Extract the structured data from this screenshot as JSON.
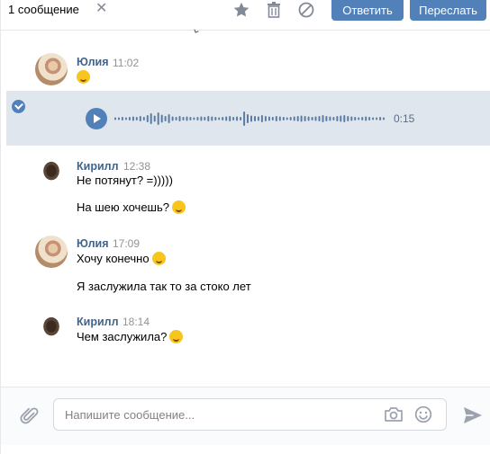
{
  "header": {
    "selection_count": "1 сообщение",
    "reply_label": "Ответить",
    "forward_label": "Переслать"
  },
  "messages": [
    {
      "author": "Юлия",
      "time": "11:02",
      "lines": [
        ""
      ],
      "emoji_after": [
        true
      ]
    },
    {
      "author": "Кирилл",
      "time": "12:38",
      "lines": [
        "Не потянут? =)))))",
        "На шею хочешь?"
      ],
      "emoji_after": [
        false,
        true
      ]
    },
    {
      "author": "Юлия",
      "time": "17:09",
      "lines": [
        "Хочу конечно",
        "Я заслужила так то за стоко лет"
      ],
      "emoji_after": [
        true,
        false
      ]
    },
    {
      "author": "Кирилл",
      "time": "18:14",
      "lines": [
        "Чем заслужила?"
      ],
      "emoji_after": [
        true
      ]
    }
  ],
  "voice_message": {
    "duration": "0:15",
    "selected": true
  },
  "composer": {
    "placeholder": "Напишите сообщение..."
  },
  "icons": {
    "close": "close-icon",
    "favorite": "star-icon",
    "delete": "trash-icon",
    "spam": "block-icon",
    "attach": "paperclip-icon",
    "camera": "camera-icon",
    "emoji": "smile-icon",
    "send": "send-icon",
    "check": "check-icon",
    "play": "play-icon"
  },
  "colors": {
    "accent": "#5181b8",
    "author": "#42648b",
    "selected_row": "#dfe6ee",
    "icon_gray": "#828a99"
  }
}
